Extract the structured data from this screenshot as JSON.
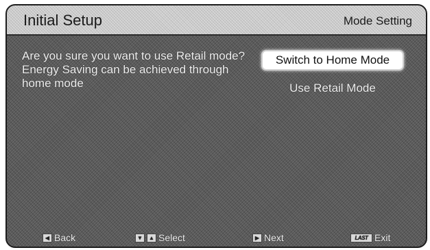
{
  "header": {
    "title": "Initial Setup",
    "mode_label": "Mode Setting"
  },
  "dialog": {
    "question": "Are you sure you want to use Retail mode? Energy Saving can be achieved through home mode",
    "options": [
      {
        "label": "Switch to Home Mode",
        "selected": true
      },
      {
        "label": "Use Retail Mode",
        "selected": false
      }
    ]
  },
  "footer": {
    "back_label": "Back",
    "select_label": "Select",
    "next_label": "Next",
    "last_key_label": "LAST",
    "exit_label": "Exit"
  },
  "icons": {
    "back": "left-arrow-key-icon",
    "select": "up-down-arrow-keys-icon",
    "next": "right-arrow-key-icon",
    "exit": "last-key-icon"
  }
}
